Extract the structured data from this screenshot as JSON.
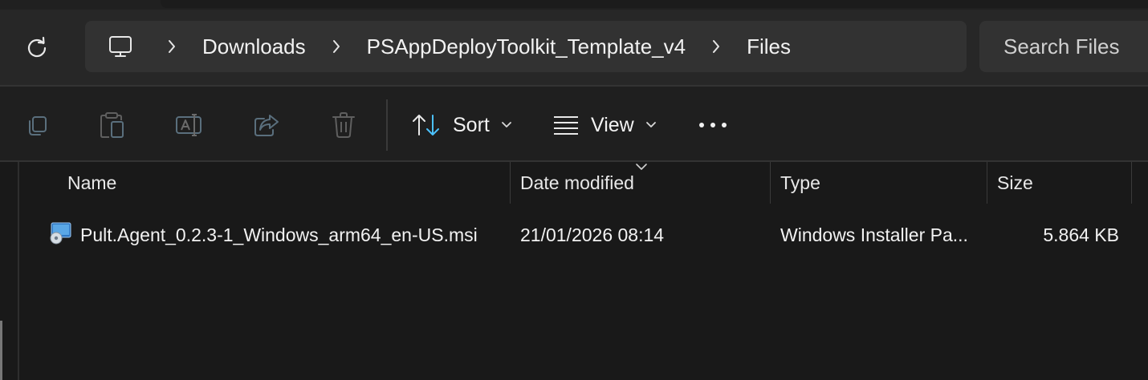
{
  "address": {
    "breadcrumbs": [
      "Downloads",
      "PSAppDeployToolkit_Template_v4",
      "Files"
    ],
    "pc_icon": "computer-icon",
    "refresh_icon": "refresh-icon",
    "separator_icon": "chevron-right-icon"
  },
  "search": {
    "placeholder": "Search Files"
  },
  "toolbar": {
    "icons": [
      "copy-icon",
      "paste-icon",
      "rename-icon",
      "share-icon",
      "delete-icon"
    ],
    "sort_label": "Sort",
    "view_label": "View",
    "more_icon": "more-icon",
    "accent": "#4cc2ff"
  },
  "columns": {
    "name": "Name",
    "date_modified": "Date modified",
    "type": "Type",
    "size": "Size"
  },
  "files": [
    {
      "name": "Pult.Agent_0.2.3-1_Windows_arm64_en-US.msi",
      "date_modified": "21/01/2026 08:14",
      "type": "Windows Installer Pa...",
      "size": "5.864 KB",
      "icon": "msi-installer-icon"
    }
  ]
}
